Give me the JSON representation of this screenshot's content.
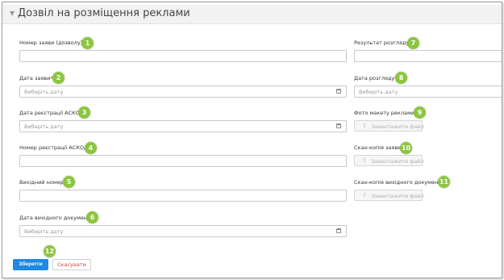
{
  "section": {
    "collapse_icon": "chevron-down-icon",
    "title": "Дозвіл на розміщення реклами"
  },
  "left": {
    "application_number": {
      "label": "Номер заяви (дозволу)",
      "required": "*",
      "value": ""
    },
    "application_date": {
      "label": "Дата заяви",
      "required": "*",
      "placeholder": "Виберіть дату"
    },
    "askod_registration_date": {
      "label": "Дата реєстрації АСКОД",
      "placeholder": "Виберіть дату"
    },
    "askod_registration_number": {
      "label": "Номер реєстрації АСКОД",
      "value": ""
    },
    "outgoing_number": {
      "label": "Вихідний номер",
      "value": ""
    },
    "outgoing_document_date": {
      "label": "Дата вихідного документа",
      "placeholder": "Виберіть дату"
    }
  },
  "right": {
    "review_result": {
      "label": "Результат розгляду",
      "required": "*",
      "value": ""
    },
    "review_date": {
      "label": "Дата розгляду",
      "required": "*",
      "placeholder": "Виберіть дату"
    },
    "ad_layout_photo": {
      "label": "Фото макету реклами",
      "required": "*",
      "upload_label": "Завантажити файл"
    },
    "application_scan": {
      "label": "Скан-копія заяви",
      "upload_label": "Завантажити файл"
    },
    "outgoing_document_scan": {
      "label": "Скан-копія вихідного документа",
      "upload_label": "Завантажити файл"
    }
  },
  "badges": [
    "1",
    "2",
    "3",
    "4",
    "5",
    "6",
    "7",
    "8",
    "9",
    "10",
    "11",
    "12"
  ],
  "actions": {
    "save_label": "Зберегти",
    "cancel_label": "Скасувати"
  },
  "colors": {
    "badge": "#8cc63f",
    "primary_button": "#1e88e5",
    "cancel_text": "#e53935",
    "required_mark": "#e02020"
  }
}
